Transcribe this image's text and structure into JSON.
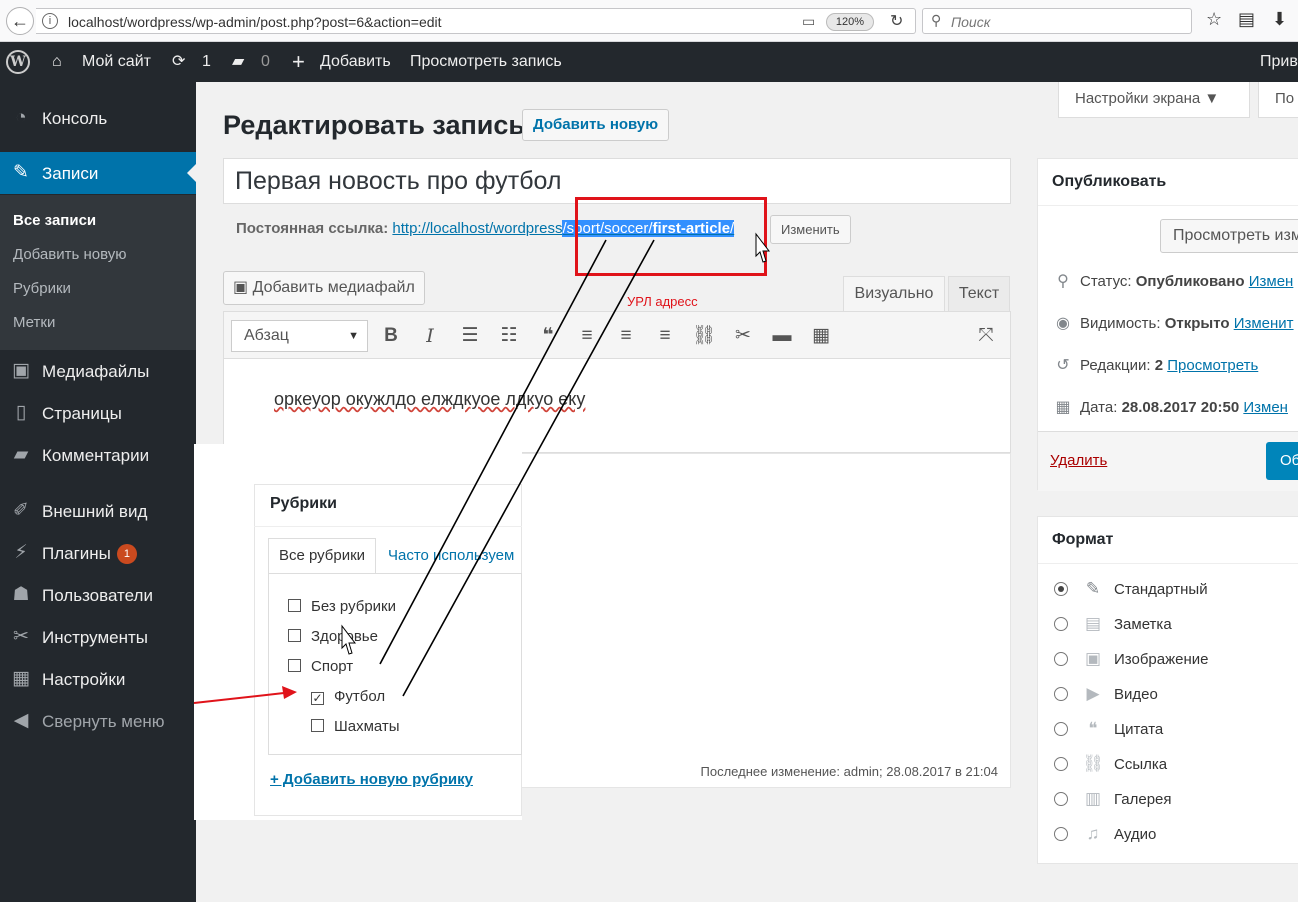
{
  "browser": {
    "url": "localhost/wordpress/wp-admin/post.php?post=6&action=edit",
    "zoom": "120%",
    "search_placeholder": "Поиск"
  },
  "adminbar": {
    "site": "Мой сайт",
    "updates": "1",
    "comments": "0",
    "add": "Добавить",
    "view": "Просмотреть запись",
    "greeting": "Прив"
  },
  "sidebar": {
    "items": [
      {
        "label": "Консоль",
        "icon": "dashboard-icon"
      },
      {
        "label": "Записи",
        "icon": "pin-icon"
      },
      {
        "label": "Медиафайлы",
        "icon": "media-icon"
      },
      {
        "label": "Страницы",
        "icon": "pages-icon"
      },
      {
        "label": "Комментарии",
        "icon": "comment-icon"
      },
      {
        "label": "Внешний вид",
        "icon": "appearance-icon"
      },
      {
        "label": "Плагины",
        "icon": "plugin-icon"
      },
      {
        "label": "Пользователи",
        "icon": "users-icon"
      },
      {
        "label": "Инструменты",
        "icon": "tools-icon"
      },
      {
        "label": "Настройки",
        "icon": "settings-icon"
      },
      {
        "label": "Свернуть меню",
        "icon": "collapse-icon"
      }
    ],
    "submenu": [
      "Все записи",
      "Добавить новую",
      "Рубрики",
      "Метки"
    ],
    "plugins_badge": "1"
  },
  "screen": {
    "options": "Настройки экрана",
    "help": "По"
  },
  "editor": {
    "page_title": "Редактировать запись",
    "add_new": "Добавить новую",
    "post_title": "Первая новость про футбол",
    "permalink_label": "Постоянная ссылка:",
    "permalink_base": "http://localhost/wordpress",
    "permalink_path": "/sport/soccer/",
    "permalink_slug": "first-article",
    "permalink_end": "/",
    "edit_slug": "Изменить",
    "annotation": "УРЛ адресс",
    "add_media": "Добавить медиафайл",
    "tab_visual": "Визуально",
    "tab_text": "Текст",
    "format": "Абзац",
    "content": "оркеуор окужлдо елждкуое лдкуо еку",
    "last_edit": "Последнее изменение: admin; 28.08.2017 в 21:04"
  },
  "categories": {
    "title": "Рубрики",
    "tab_all": "Все рубрики",
    "tab_popular": "Часто используем",
    "items": [
      {
        "label": "Без рубрики",
        "checked": false
      },
      {
        "label": "Здоровье",
        "checked": false
      },
      {
        "label": "Спорт",
        "checked": false
      },
      {
        "label": "Футбол",
        "checked": true
      },
      {
        "label": "Шахматы",
        "checked": false
      }
    ],
    "add": "+ Добавить новую рубрику"
  },
  "publish": {
    "title": "Опубликовать",
    "preview": "Просмотреть изм",
    "status_label": "Статус:",
    "status_value": "Опубликовано",
    "status_link": "Измен",
    "visibility_label": "Видимость:",
    "visibility_value": "Открыто",
    "visibility_link": "Изменит",
    "revisions_label": "Редакции:",
    "revisions_value": "2",
    "revisions_link": "Просмотреть",
    "date_label": "Дата:",
    "date_value": "28.08.2017 20:50",
    "date_link": "Измен",
    "delete": "Удалить",
    "update": "Об"
  },
  "format_box": {
    "title": "Формат",
    "items": [
      {
        "label": "Стандартный",
        "selected": true
      },
      {
        "label": "Заметка",
        "selected": false
      },
      {
        "label": "Изображение",
        "selected": false
      },
      {
        "label": "Видео",
        "selected": false
      },
      {
        "label": "Цитата",
        "selected": false
      },
      {
        "label": "Ссылка",
        "selected": false
      },
      {
        "label": "Галерея",
        "selected": false
      },
      {
        "label": "Аудио",
        "selected": false
      }
    ]
  }
}
